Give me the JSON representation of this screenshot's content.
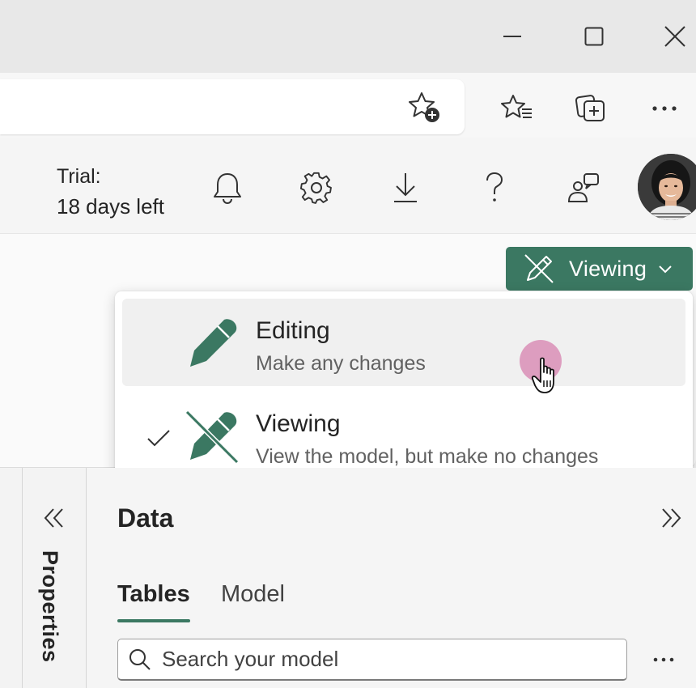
{
  "window": {
    "minimize_icon": "minimize-icon",
    "maximize_icon": "maximize-icon",
    "close_icon": "close-icon"
  },
  "browser": {
    "add_favorite_icon": "star-add-icon",
    "favorites_icon": "favorites-list-icon",
    "collections_icon": "collections-add-icon",
    "more_icon": "ellipsis-icon"
  },
  "header": {
    "trial_label": "Trial:",
    "trial_days": "18 days left",
    "icons": [
      "bell-icon",
      "gear-icon",
      "download-icon",
      "help-icon",
      "feedback-icon"
    ]
  },
  "mode_button": {
    "label": "Viewing"
  },
  "mode_menu": {
    "options": [
      {
        "title": "Editing",
        "description": "Make any changes",
        "selected": false
      },
      {
        "title": "Viewing",
        "description": "View the model, but make no changes",
        "selected": true
      }
    ]
  },
  "properties_pane": {
    "label": "Properties"
  },
  "data_pane": {
    "title": "Data",
    "tabs": [
      {
        "label": "Tables",
        "active": true
      },
      {
        "label": "Model",
        "active": false
      }
    ],
    "search": {
      "placeholder": "Search your model"
    }
  },
  "colors": {
    "accent": "#3b7862",
    "cursor_highlight": "#d782af"
  }
}
